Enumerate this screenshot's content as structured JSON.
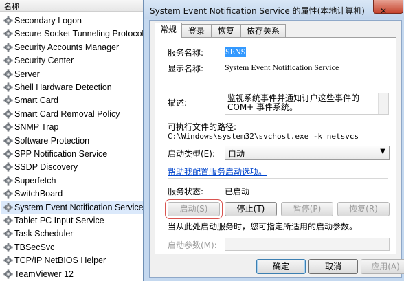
{
  "services": {
    "header": "名称",
    "items": [
      "Secondary Logon",
      "Secure Socket Tunneling Protocol Se",
      "Security Accounts Manager",
      "Security Center",
      "Server",
      "Shell Hardware Detection",
      "Smart Card",
      "Smart Card Removal Policy",
      "SNMP Trap",
      "Software Protection",
      "SPP Notification Service",
      "SSDP Discovery",
      "Superfetch",
      "SwitchBoard",
      "System Event Notification Service",
      "Tablet PC Input Service",
      "Task Scheduler",
      "TBSecSvc",
      "TCP/IP NetBIOS Helper",
      "TeamViewer 12"
    ]
  },
  "dialog": {
    "title": "System Event Notification Service 的属性(本地计算机)",
    "close": "✕",
    "tabs": [
      "常规",
      "登录",
      "恢复",
      "依存关系"
    ],
    "service_name_label": "服务名称:",
    "service_name": "SENS",
    "display_name_label": "显示名称:",
    "display_name": "System Event Notification Service",
    "description_label": "描述:",
    "description": "监视系统事件并通知订户这些事件的 COM+ 事件系统。",
    "exe_path_label": "可执行文件的路径:",
    "exe_path": "C:\\Windows\\system32\\svchost.exe -k netsvcs",
    "startup_type_label": "启动类型(E):",
    "startup_type": "自动",
    "help_link": "帮助我配置服务启动选项。",
    "status_label": "服务状态:",
    "status_value": "已启动",
    "buttons": {
      "start": "启动(S)",
      "stop": "停止(T)",
      "pause": "暂停(P)",
      "resume": "恢复(R)"
    },
    "hint": "当从此处启动服务时，您可指定所适用的启动参数。",
    "params_label": "启动参数(M):",
    "footer": {
      "ok": "确定",
      "cancel": "取消",
      "apply": "应用(A)"
    }
  }
}
